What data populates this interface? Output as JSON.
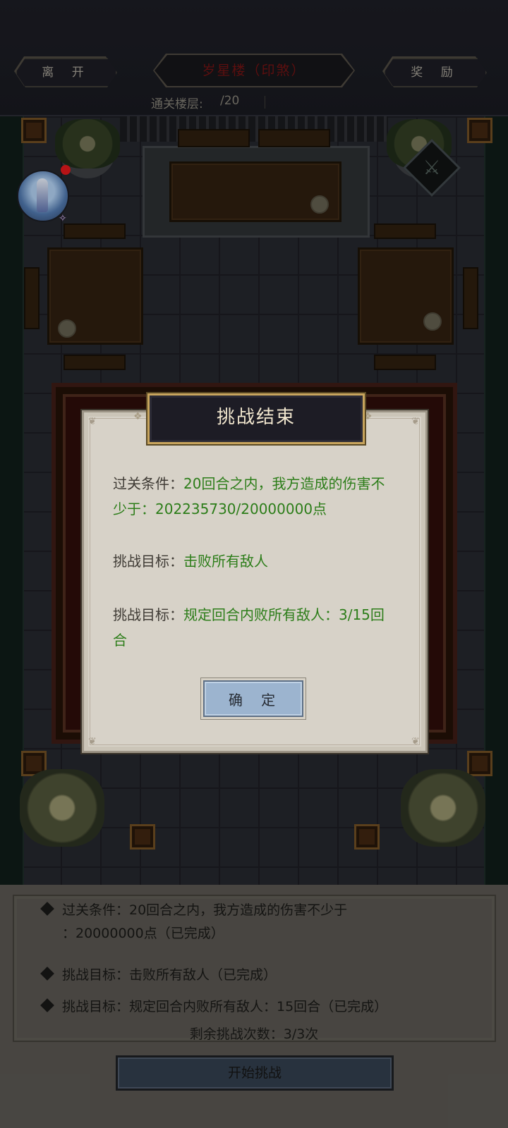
{
  "header": {
    "leave_label": "离 开",
    "title": "岁星楼（印煞）",
    "reward_label": "奖 励",
    "floor_label": "通关楼层:",
    "floor_current": "",
    "floor_total": "/20",
    "record_text": ""
  },
  "map": {
    "avatar_icon": "character-portrait-icon",
    "notification": "red-dot",
    "weapon_icon": "weapon-skill-icon"
  },
  "modal": {
    "title": "挑战结束",
    "condition_label": "过关条件：",
    "condition_value_1": "20回合之内，我方造成的伤害不",
    "condition_value_2": "少于：202235730/20000000点",
    "goal1_label": "挑战目标：",
    "goal1_value": "击败所有敌人",
    "goal2_label": "挑战目标：",
    "goal2_value_1": "规定回合内败所有敌人：3/15回",
    "goal2_value_2": "合",
    "confirm_label": "确 定"
  },
  "bottom": {
    "conditions": [
      {
        "line1": "过关条件：20回合之内，我方造成的伤害不少于",
        "line2": "：20000000点（已完成）"
      },
      {
        "line1": "挑战目标：击败所有敌人（已完成）"
      },
      {
        "line1": "挑战目标：规定回合内败所有敌人：15回合（已完成）"
      }
    ],
    "remaining": "剩余挑战次数：3/3次",
    "start_label": "开始挑战"
  },
  "colors": {
    "success_green": "#2c7d19",
    "title_gold": "#c7a45d",
    "confirm_blue": "#9cb4cf",
    "title_red": "#6d1212"
  }
}
